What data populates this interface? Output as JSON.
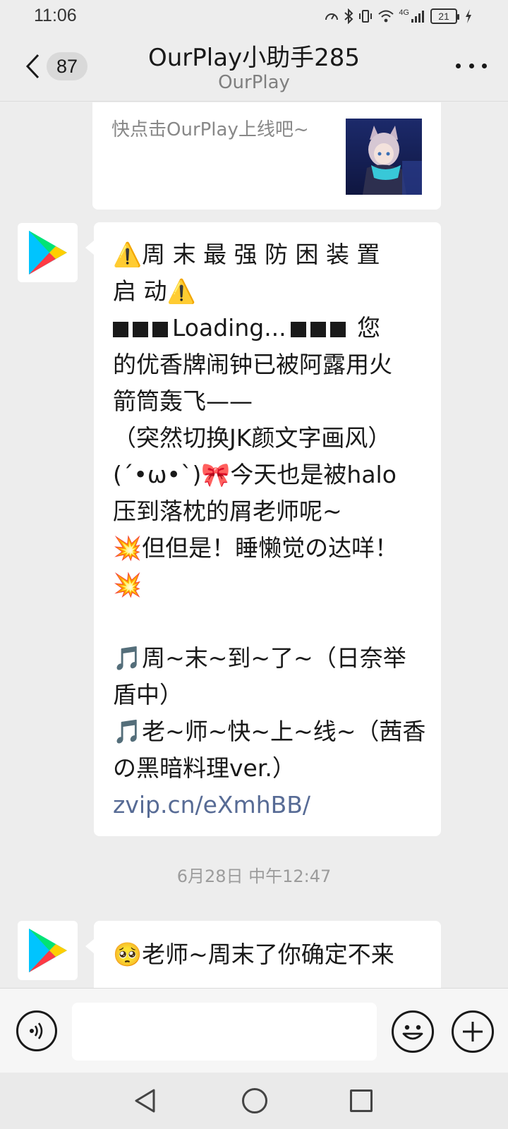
{
  "status_bar": {
    "time": "11:06",
    "network": "4G",
    "battery": "21",
    "icons": [
      "speed-icon",
      "bluetooth-icon",
      "vibrate-icon",
      "wifi-icon",
      "signal-icon",
      "battery-icon",
      "charging-icon"
    ]
  },
  "header": {
    "unread_count": "87",
    "title": "OurPlay小助手285",
    "subtitle": "OurPlay"
  },
  "messages": {
    "card_top": {
      "cut_text": "…",
      "description": "快点击OurPlay上线吧~",
      "thumbnail_icon": "anime-character-thumbnail"
    },
    "msg1": {
      "lines": [
        "周 末 最 强 防 困 装 置",
        "启 动",
        "Loading...",
        "您",
        "的优香牌闹钟已被阿露用火",
        "箭筒轰飞——",
        "（突然切换JK颜文字画风）",
        "(´•ω•`)",
        "今天也是被halo",
        "压到落枕的屑老师呢~",
        "但但是！睡懒觉の达咩！",
        "周~末~到~了~（日奈举",
        "盾中）",
        "老~师~快~上~线~（茜香",
        "の黑暗料理ver.）"
      ],
      "link": "zvip.cn/eXmhBB/",
      "emoji_warning": "⚠️",
      "emoji_collision": "💥",
      "emoji_music": "🎵",
      "emoji_bow": "🎀"
    },
    "divider_time": "6月28日 中午12:47",
    "msg2": {
      "emoji": "🥺",
      "text": "老师~周末了你确定不来"
    }
  },
  "input_bar": {
    "placeholder": ""
  },
  "colors": {
    "background": "#ededed",
    "link": "#576b95",
    "bubble": "#ffffff"
  }
}
